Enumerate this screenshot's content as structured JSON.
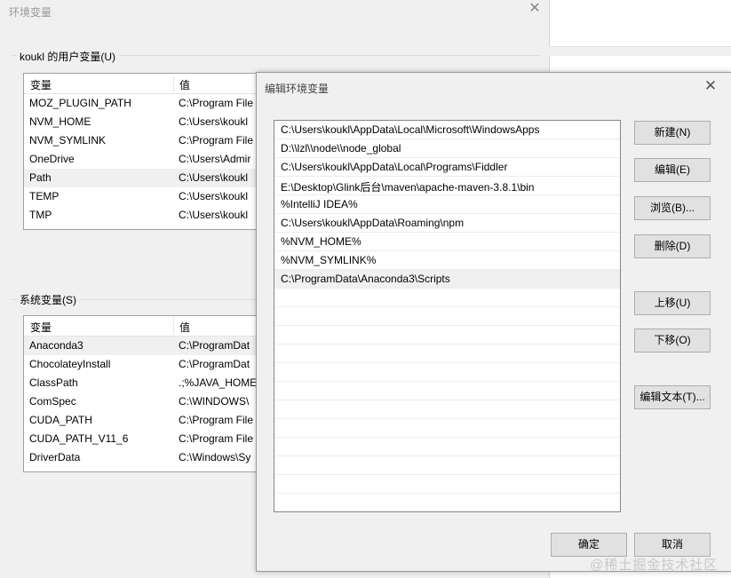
{
  "env_window": {
    "title": "环境变量",
    "user_group_label": "koukl 的用户变量(U)",
    "user_columns": [
      "变量",
      "值"
    ],
    "user_vars": [
      {
        "name": "MOZ_PLUGIN_PATH",
        "value": "C:\\Program File"
      },
      {
        "name": "NVM_HOME",
        "value": "C:\\Users\\koukl"
      },
      {
        "name": "NVM_SYMLINK",
        "value": "C:\\Program File"
      },
      {
        "name": "OneDrive",
        "value": "C:\\Users\\Admir"
      },
      {
        "name": "Path",
        "value": "C:\\Users\\koukl"
      },
      {
        "name": "TEMP",
        "value": "C:\\Users\\koukl"
      },
      {
        "name": "TMP",
        "value": "C:\\Users\\koukl"
      }
    ],
    "user_selected_index": 4,
    "system_group_label": "系统变量(S)",
    "system_columns": [
      "变量",
      "值"
    ],
    "system_vars": [
      {
        "name": "Anaconda3",
        "value": "C:\\ProgramDat"
      },
      {
        "name": "ChocolateyInstall",
        "value": "C:\\ProgramDat"
      },
      {
        "name": "ClassPath",
        "value": ".;%JAVA_HOME"
      },
      {
        "name": "ComSpec",
        "value": "C:\\WINDOWS\\"
      },
      {
        "name": "CUDA_PATH",
        "value": "C:\\Program File"
      },
      {
        "name": "CUDA_PATH_V11_6",
        "value": "C:\\Program File"
      },
      {
        "name": "DriverData",
        "value": "C:\\Windows\\Sy"
      }
    ],
    "system_selected_index": 0
  },
  "edit_dialog": {
    "title": "编辑环境变量",
    "paths": [
      "C:\\Users\\koukl\\AppData\\Local\\Microsoft\\WindowsApps",
      "D:\\\\lzl\\\\node\\\\node_global",
      "C:\\Users\\koukl\\AppData\\Local\\Programs\\Fiddler",
      "E:\\Desktop\\Glink后台\\maven\\apache-maven-3.8.1\\bin",
      "%IntelliJ IDEA%",
      "C:\\Users\\koukl\\AppData\\Roaming\\npm",
      "%NVM_HOME%",
      "%NVM_SYMLINK%",
      "C:\\ProgramData\\Anaconda3\\Scripts"
    ],
    "selected_index": 8,
    "buttons": {
      "new": "新建(N)",
      "edit": "编辑(E)",
      "browse": "浏览(B)...",
      "delete": "删除(D)",
      "move_up": "上移(U)",
      "move_down": "下移(O)",
      "edit_text": "编辑文本(T)...",
      "ok": "确定",
      "cancel": "取消"
    }
  },
  "watermark": "@稀土掘金技术社区"
}
